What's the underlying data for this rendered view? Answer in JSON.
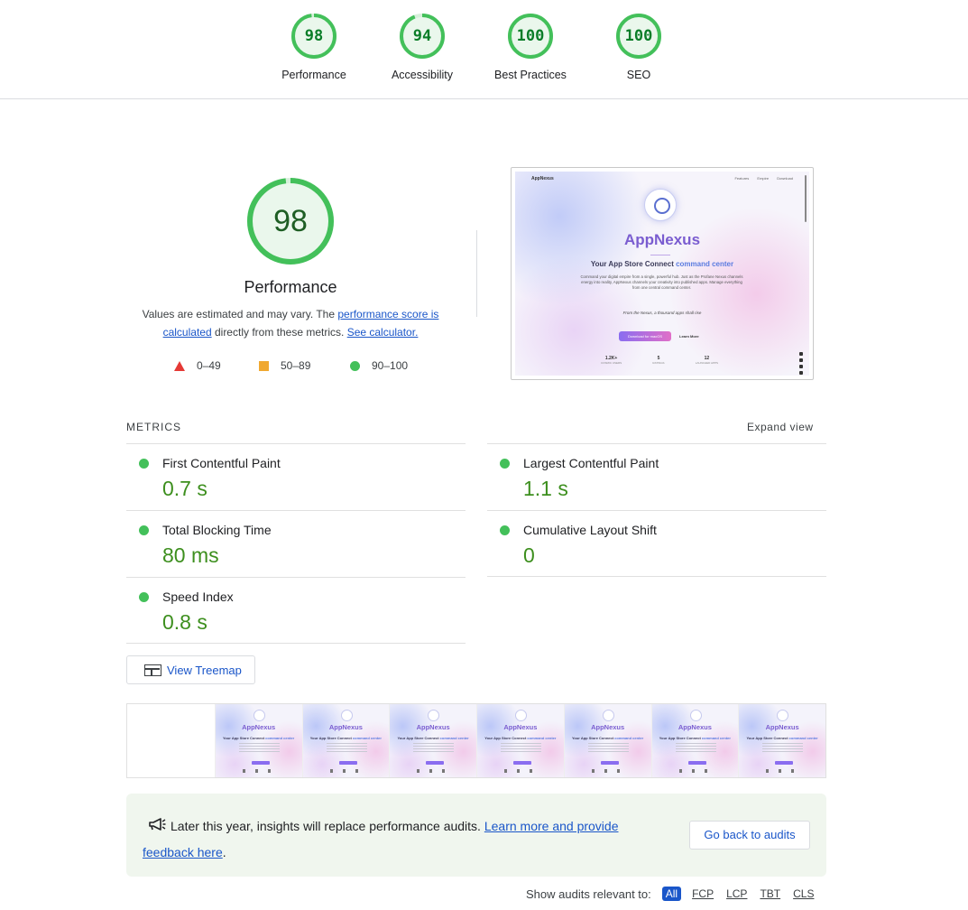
{
  "top_gauges": [
    {
      "label": "Performance",
      "score": "98",
      "value": 0.98
    },
    {
      "label": "Accessibility",
      "score": "94",
      "value": 0.94
    },
    {
      "label": "Best Practices",
      "score": "100",
      "value": 1.0
    },
    {
      "label": "SEO",
      "score": "100",
      "value": 1.0
    }
  ],
  "summary": {
    "score": "98",
    "value": 0.98,
    "title": "Performance",
    "note_before": "Values are estimated and may vary. The ",
    "note_link1": "performance score is calculated",
    "note_middle": " directly from these metrics. ",
    "note_link2": "See calculator.",
    "legend": [
      {
        "shape": "triangle",
        "range": "0–49"
      },
      {
        "shape": "square",
        "range": "50–89"
      },
      {
        "shape": "circle",
        "range": "90–100"
      }
    ]
  },
  "screenshot": {
    "brand": "AppNexus",
    "nav_links": [
      "Features",
      "Empire",
      "Download"
    ],
    "title": "AppNexus",
    "subtitle_prefix": "Your App Store Connect ",
    "subtitle_highlight": "command center",
    "paragraph": "Command your digital empire from a single, powerful hub. Just as the Profane Nexus channels energy into reality, AppNexus channels your creativity into published apps. Manage everything from one central command center.",
    "quote": "From the Nexus, a thousand apps shall rise",
    "download_button": "Download for macOS",
    "learn_more": "Learn More",
    "stats": [
      {
        "value": "1.2K+",
        "label": "COSMIC USERS"
      },
      {
        "value": "5",
        "label": "RATINGS"
      },
      {
        "value": "12",
        "label": "LAUNCHED APPS"
      }
    ]
  },
  "metrics": {
    "header": "METRICS",
    "expand_label": "Expand view",
    "items": [
      {
        "name": "First Contentful Paint",
        "value": "0.7 s"
      },
      {
        "name": "Largest Contentful Paint",
        "value": "1.1 s"
      },
      {
        "name": "Total Blocking Time",
        "value": "80 ms"
      },
      {
        "name": "Cumulative Layout Shift",
        "value": "0"
      },
      {
        "name": "Speed Index",
        "value": "0.8 s"
      }
    ]
  },
  "treemap_label": "View Treemap",
  "filmstrip": {
    "frame_title": "AppNexus",
    "frame_sub_prefix": "Your App Store Connect ",
    "frame_sub_highlight": "command center"
  },
  "banner": {
    "text": "Later this year, insights will replace performance audits. ",
    "link": "Learn more and provide feedback here",
    "end": ".",
    "back_button": "Go back to audits"
  },
  "filter": {
    "label": "Show audits relevant to:",
    "chips": [
      "All",
      "FCP",
      "LCP",
      "TBT",
      "CLS"
    ]
  },
  "colors": {
    "pass": "#0a7d28",
    "pass_ring": "#43c05a",
    "average": "#f0a830",
    "fail": "#e53935",
    "link": "#1a56c9"
  }
}
